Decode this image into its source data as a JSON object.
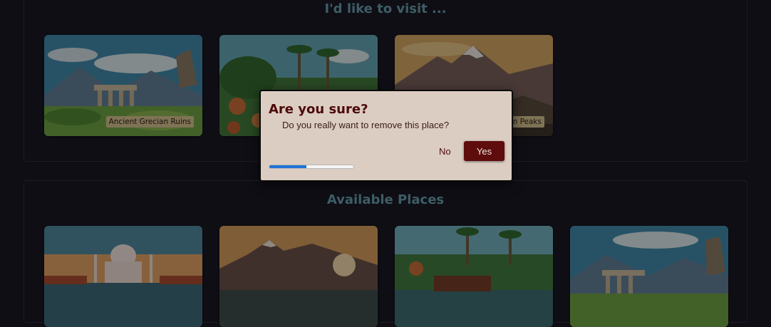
{
  "visit_section": {
    "title": "I'd like to visit ...",
    "places": [
      {
        "label": "Ancient Grecian Ruins",
        "image": "grecian-ruins"
      },
      {
        "label": "",
        "image": "tropical-jungle"
      },
      {
        "label": "Mountain Peaks",
        "image": "mountain-peaks"
      }
    ]
  },
  "available_section": {
    "title": "Available Places",
    "places": [
      {
        "image": "taj-mahal"
      },
      {
        "image": "mountain-lake"
      },
      {
        "image": "houseboat-river"
      },
      {
        "image": "grecian-ruins"
      }
    ]
  },
  "dialog": {
    "title": "Are you sure?",
    "message": "Do you really want to remove this place?",
    "no_label": "No",
    "yes_label": "Yes",
    "progress_fraction": 0.44
  },
  "colors": {
    "background": "#0f0e15",
    "section_title": "#3e5d66",
    "dialog_bg": "#dccdc2",
    "dialog_title": "#4c0a0a",
    "yes_button": "#5e0c0c",
    "progress": "#1e74d6",
    "label_bg": "#d6c08a"
  }
}
